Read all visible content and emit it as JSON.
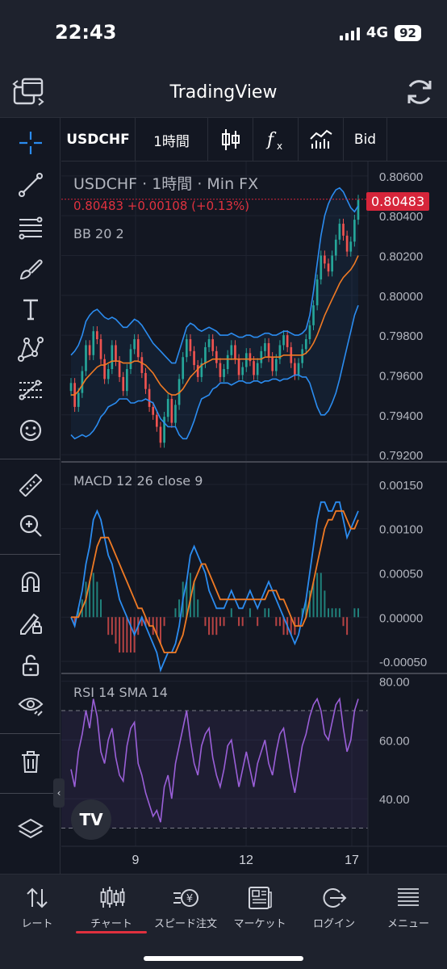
{
  "status_bar": {
    "time": "22:43",
    "network": "4G",
    "battery": "92"
  },
  "app": {
    "title": "TradingView"
  },
  "toolbar": {
    "symbol": "USDCHF",
    "interval": "1時間",
    "chart_type_icon": "candles-icon",
    "indicators_icon": "fx-icon",
    "compare_icon": "bar-chart-icon",
    "price_source": "Bid"
  },
  "left_tools": [
    "crosshair-icon",
    "trendline-icon",
    "fib-icon",
    "brush-icon",
    "text-icon",
    "pattern-icon",
    "forecast-icon",
    "emoji-icon",
    "ruler-icon",
    "zoom-in-icon",
    "magnet-icon",
    "lock-drawing-icon",
    "unlock-icon",
    "eye-icon",
    "trash-icon",
    "layers-icon"
  ],
  "legend": {
    "line1": "USDCHF · 1時間 · Min FX",
    "price_line": "0.80483  +0.00108 (+0.13%)",
    "bb": "BB 20 2",
    "macd": "MACD 12 26 close 9",
    "rsi": "RSI 14 SMA 14"
  },
  "last_price_label": "0.80483",
  "colors": {
    "bg": "#131722",
    "up": "#26a69a",
    "down": "#ef5350",
    "bb_band": "#2b8cf0",
    "bb_basis": "#f07a24",
    "macd": "#2b8cf0",
    "signal": "#f07a24",
    "rsi": "#9a5fd8",
    "price_label": "#d6253a"
  },
  "chart_data": [
    {
      "type": "line",
      "title": "USDCHF · 1時間 · Min FX",
      "yticks": [
        "0.80600",
        "0.80400",
        "0.80200",
        "0.80000",
        "0.79800",
        "0.79600",
        "0.79400",
        "0.79200"
      ],
      "ylim": [
        0.7918,
        0.8064
      ],
      "last_price": 0.80483,
      "change": "+0.00108 (+0.13%)",
      "series": [
        {
          "name": "Close",
          "values": [
            0.7956,
            0.7944,
            0.7951,
            0.7962,
            0.7975,
            0.797,
            0.7982,
            0.7978,
            0.7968,
            0.7958,
            0.7963,
            0.7975,
            0.7967,
            0.7959,
            0.7952,
            0.7963,
            0.7973,
            0.7978,
            0.7969,
            0.7961,
            0.7953,
            0.7944,
            0.794,
            0.7934,
            0.7926,
            0.7939,
            0.7948,
            0.7936,
            0.7945,
            0.7958,
            0.7969,
            0.7978,
            0.7972,
            0.7965,
            0.7959,
            0.7966,
            0.7974,
            0.7978,
            0.7972,
            0.7966,
            0.7959,
            0.7963,
            0.797,
            0.7975,
            0.7968,
            0.796,
            0.7964,
            0.7971,
            0.7967,
            0.796,
            0.7966,
            0.7972,
            0.7976,
            0.7969,
            0.7962,
            0.7968,
            0.7975,
            0.798,
            0.7974,
            0.7966,
            0.796,
            0.7966,
            0.7973,
            0.7978,
            0.7985,
            0.7995,
            0.8008,
            0.802,
            0.8016,
            0.8012,
            0.802,
            0.8028,
            0.8036,
            0.803,
            0.8022,
            0.8027,
            0.8038,
            0.8048
          ]
        },
        {
          "name": "BB Upper",
          "values": [
            0.797,
            0.7972,
            0.7975,
            0.798,
            0.7987,
            0.799,
            0.7992,
            0.7993,
            0.7991,
            0.7989,
            0.7988,
            0.7989,
            0.7988,
            0.7986,
            0.7984,
            0.7984,
            0.7986,
            0.7988,
            0.7987,
            0.7985,
            0.7982,
            0.7979,
            0.7976,
            0.7974,
            0.7972,
            0.797,
            0.7968,
            0.7966,
            0.7966,
            0.7972,
            0.7978,
            0.7984,
            0.7986,
            0.7985,
            0.7983,
            0.7982,
            0.7983,
            0.7984,
            0.7983,
            0.7982,
            0.798,
            0.798,
            0.798,
            0.7981,
            0.798,
            0.7979,
            0.7979,
            0.798,
            0.798,
            0.7979,
            0.7979,
            0.798,
            0.7981,
            0.7981,
            0.798,
            0.798,
            0.7981,
            0.7982,
            0.7982,
            0.7981,
            0.798,
            0.798,
            0.7981,
            0.7983,
            0.799,
            0.8002,
            0.8016,
            0.803,
            0.804,
            0.8046,
            0.805,
            0.8053,
            0.8054,
            0.8052,
            0.8048,
            0.8044,
            0.8042,
            0.8045
          ]
        },
        {
          "name": "BB Basis",
          "values": [
            0.795,
            0.795,
            0.7952,
            0.7955,
            0.7958,
            0.796,
            0.7962,
            0.7964,
            0.7965,
            0.7965,
            0.7966,
            0.7967,
            0.7967,
            0.7967,
            0.7966,
            0.7966,
            0.7966,
            0.7967,
            0.7967,
            0.7966,
            0.7965,
            0.7963,
            0.7961,
            0.7958,
            0.7955,
            0.7953,
            0.7951,
            0.795,
            0.795,
            0.7951,
            0.7953,
            0.7956,
            0.7959,
            0.7961,
            0.7963,
            0.7965,
            0.7966,
            0.7967,
            0.7968,
            0.7968,
            0.7968,
            0.7968,
            0.7968,
            0.7968,
            0.7968,
            0.7968,
            0.7968,
            0.7968,
            0.7968,
            0.7968,
            0.7968,
            0.7968,
            0.7969,
            0.7969,
            0.7969,
            0.7969,
            0.7969,
            0.797,
            0.797,
            0.797,
            0.797,
            0.797,
            0.797,
            0.7971,
            0.7973,
            0.7976,
            0.798,
            0.7985,
            0.799,
            0.7994,
            0.7998,
            0.8002,
            0.8006,
            0.8009,
            0.8011,
            0.8013,
            0.8016,
            0.802
          ]
        },
        {
          "name": "BB Lower",
          "values": [
            0.793,
            0.7928,
            0.7929,
            0.793,
            0.7929,
            0.793,
            0.7932,
            0.7935,
            0.7939,
            0.7941,
            0.7944,
            0.7945,
            0.7946,
            0.7948,
            0.7948,
            0.7948,
            0.7946,
            0.7946,
            0.7947,
            0.7947,
            0.7948,
            0.7947,
            0.7946,
            0.7942,
            0.7938,
            0.7936,
            0.7934,
            0.7934,
            0.7934,
            0.793,
            0.7928,
            0.7928,
            0.7932,
            0.7937,
            0.7943,
            0.7948,
            0.7949,
            0.795,
            0.7953,
            0.7954,
            0.7956,
            0.7956,
            0.7956,
            0.7955,
            0.7956,
            0.7957,
            0.7957,
            0.7956,
            0.7956,
            0.7957,
            0.7957,
            0.7956,
            0.7957,
            0.7957,
            0.7958,
            0.7958,
            0.7957,
            0.7958,
            0.7958,
            0.7959,
            0.796,
            0.796,
            0.7959,
            0.7959,
            0.7956,
            0.795,
            0.7944,
            0.794,
            0.794,
            0.7942,
            0.7946,
            0.7951,
            0.7958,
            0.7966,
            0.7974,
            0.7982,
            0.799,
            0.7995
          ]
        }
      ]
    },
    {
      "type": "line",
      "title": "MACD 12 26 close 9",
      "yticks": [
        "0.00150",
        "0.00100",
        "0.00050",
        "0.00000",
        "-0.00050"
      ],
      "ylim": [
        -0.0006,
        0.0017
      ],
      "series": [
        {
          "name": "MACD",
          "values": [
            0.0,
            -0.0001,
            0.0001,
            0.0003,
            0.0006,
            0.0008,
            0.0011,
            0.0012,
            0.0011,
            0.0009,
            0.0007,
            0.0006,
            0.0004,
            0.0002,
            0.0001,
            0.0,
            -0.0001,
            -0.0002,
            -0.0001,
            0.0,
            -0.0001,
            -0.0002,
            -0.0003,
            -0.0004,
            -0.0006,
            -0.0005,
            -0.0004,
            -0.0004,
            -0.0003,
            -0.0001,
            0.0002,
            0.0004,
            0.0007,
            0.0008,
            0.0007,
            0.0006,
            0.0005,
            0.0003,
            0.0002,
            0.0001,
            0.0001,
            0.0001,
            0.0002,
            0.0003,
            0.0002,
            0.0001,
            0.0001,
            0.0002,
            0.0003,
            0.0002,
            0.0001,
            0.0002,
            0.0003,
            0.0004,
            0.0003,
            0.0002,
            0.0001,
            0.0,
            -0.0001,
            -0.0002,
            -0.0003,
            -0.0002,
            0.0,
            0.0002,
            0.0005,
            0.0008,
            0.0011,
            0.0013,
            0.0013,
            0.0012,
            0.0012,
            0.0013,
            0.0013,
            0.0011,
            0.0009,
            0.001,
            0.0011,
            0.0012
          ]
        },
        {
          "name": "Signal",
          "values": [
            0.0,
            0.0,
            0.0,
            0.0001,
            0.0002,
            0.0004,
            0.0006,
            0.0008,
            0.0009,
            0.0009,
            0.0009,
            0.0008,
            0.0007,
            0.0006,
            0.0005,
            0.0004,
            0.0003,
            0.0002,
            0.0001,
            0.0001,
            0.0,
            -0.0001,
            -0.0001,
            -0.0002,
            -0.0003,
            -0.0004,
            -0.0004,
            -0.0004,
            -0.0004,
            -0.0003,
            -0.0002,
            0.0,
            0.0002,
            0.0004,
            0.0005,
            0.0006,
            0.0006,
            0.0005,
            0.0004,
            0.0003,
            0.0002,
            0.0002,
            0.0002,
            0.0002,
            0.0002,
            0.0002,
            0.0002,
            0.0002,
            0.0002,
            0.0002,
            0.0002,
            0.0002,
            0.0002,
            0.0003,
            0.0003,
            0.0003,
            0.0002,
            0.0002,
            0.0001,
            0.0,
            -0.0001,
            -0.0001,
            -0.0001,
            0.0,
            0.0002,
            0.0004,
            0.0006,
            0.0008,
            0.001,
            0.0011,
            0.0011,
            0.0012,
            0.0012,
            0.0012,
            0.0011,
            0.001,
            0.001,
            0.0011
          ]
        }
      ]
    },
    {
      "type": "line",
      "title": "RSI 14 SMA 14",
      "yticks": [
        "80.00",
        "60.00",
        "40.00"
      ],
      "ylim": [
        26,
        81
      ],
      "bands": [
        70,
        30
      ],
      "series": [
        {
          "name": "RSI",
          "values": [
            50,
            44,
            56,
            62,
            70,
            64,
            74,
            68,
            56,
            52,
            60,
            64,
            54,
            48,
            46,
            58,
            64,
            66,
            52,
            48,
            42,
            38,
            34,
            36,
            32,
            44,
            48,
            40,
            52,
            58,
            64,
            70,
            60,
            52,
            48,
            58,
            62,
            64,
            54,
            48,
            44,
            50,
            58,
            60,
            52,
            44,
            50,
            56,
            50,
            44,
            52,
            56,
            60,
            52,
            48,
            56,
            62,
            64,
            56,
            48,
            42,
            50,
            58,
            62,
            68,
            72,
            74,
            70,
            62,
            60,
            66,
            72,
            74,
            64,
            56,
            60,
            70,
            74
          ]
        }
      ]
    }
  ],
  "time_axis": [
    "9",
    "12",
    "17"
  ],
  "bottom_nav": [
    {
      "label": "レート",
      "icon": "rates-icon"
    },
    {
      "label": "チャート",
      "icon": "chart-candles-icon",
      "active": true
    },
    {
      "label": "スピード注文",
      "icon": "speed-order-icon"
    },
    {
      "label": "マーケット",
      "icon": "news-icon"
    },
    {
      "label": "ログイン",
      "icon": "login-icon"
    },
    {
      "label": "メニュー",
      "icon": "menu-icon"
    }
  ]
}
